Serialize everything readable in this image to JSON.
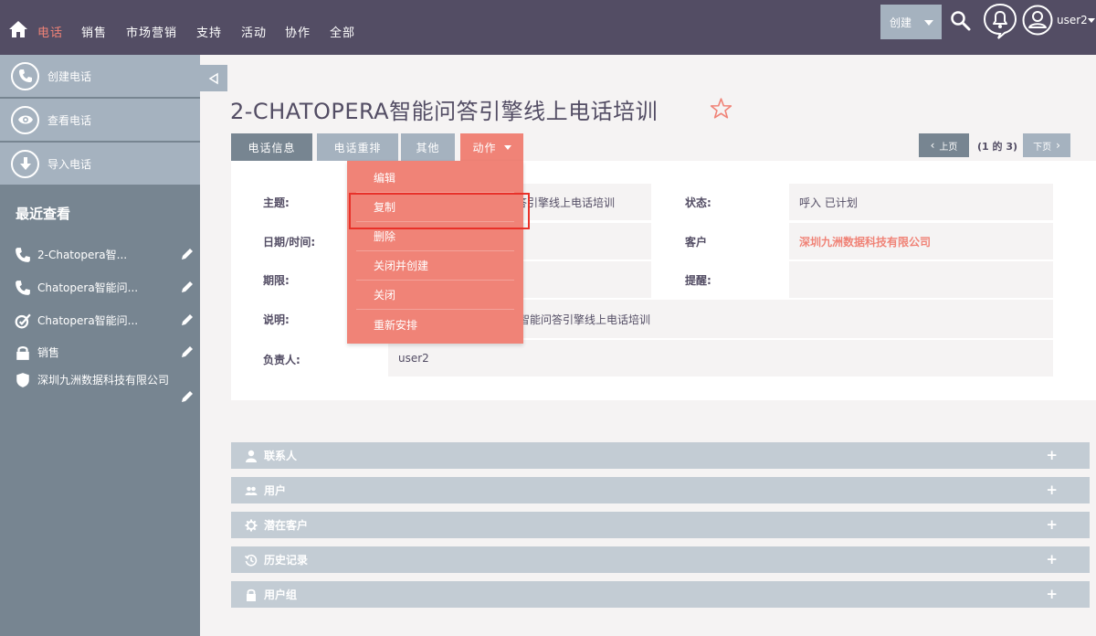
{
  "nav": {
    "items": [
      "电话",
      "销售",
      "市场营销",
      "支持",
      "活动",
      "协作",
      "全部"
    ],
    "create_label": "创建",
    "user_label": "user2"
  },
  "sidebar": {
    "actions": [
      {
        "label": "创建电话",
        "icon": "phone-icon"
      },
      {
        "label": "查看电话",
        "icon": "eye-icon"
      },
      {
        "label": "导入电话",
        "icon": "download-icon"
      }
    ],
    "recent_title": "最近查看",
    "recent": [
      {
        "label": "2-Chatopera智...",
        "icon": "phone-icon"
      },
      {
        "label": "Chatopera智能问...",
        "icon": "phone-icon"
      },
      {
        "label": "Chatopera智能问...",
        "icon": "task-check-icon"
      },
      {
        "label": "销售",
        "icon": "lock-icon"
      },
      {
        "label": "深圳九洲数据科技有限公司",
        "icon": "shield-icon"
      }
    ]
  },
  "record": {
    "title": "2-CHATOPERA智能问答引擎线上电话培训",
    "tabs": [
      "电话信息",
      "电话重排",
      "其他",
      "动作"
    ],
    "pager": {
      "prev": "上页",
      "count": "(1 的 3)",
      "next": "下页"
    },
    "fields": {
      "subject_label": "主题:",
      "subject_value": "智能问答引擎线上电话培训",
      "status_label": "状态:",
      "status_value": "呼入 已计划",
      "datetime_label": "日期/时间:",
      "account_label": "客户",
      "account_value": "深圳九洲数据科技有限公司",
      "duration_label": "期限:",
      "reminder_label": "提醒:",
      "description_label": "说明:",
      "description_value": "智能问答引擎线上电话培训",
      "assigned_label": "负责人:",
      "assigned_value": "user2"
    }
  },
  "actions_menu": [
    "编辑",
    "复制",
    "删除",
    "关闭并创建",
    "关闭",
    "重新安排"
  ],
  "subpanels": [
    {
      "label": "联系人",
      "icon": "person-icon"
    },
    {
      "label": "用户",
      "icon": "users-icon"
    },
    {
      "label": "潜在客户",
      "icon": "gear-icon"
    },
    {
      "label": "历史记录",
      "icon": "history-icon"
    },
    {
      "label": "用户组",
      "icon": "lock-icon"
    }
  ],
  "colors": {
    "accent": "#f08377",
    "nav_bg": "#534d64",
    "sidebar_bg": "#778591",
    "tab_inactive": "#a5b2bf"
  }
}
